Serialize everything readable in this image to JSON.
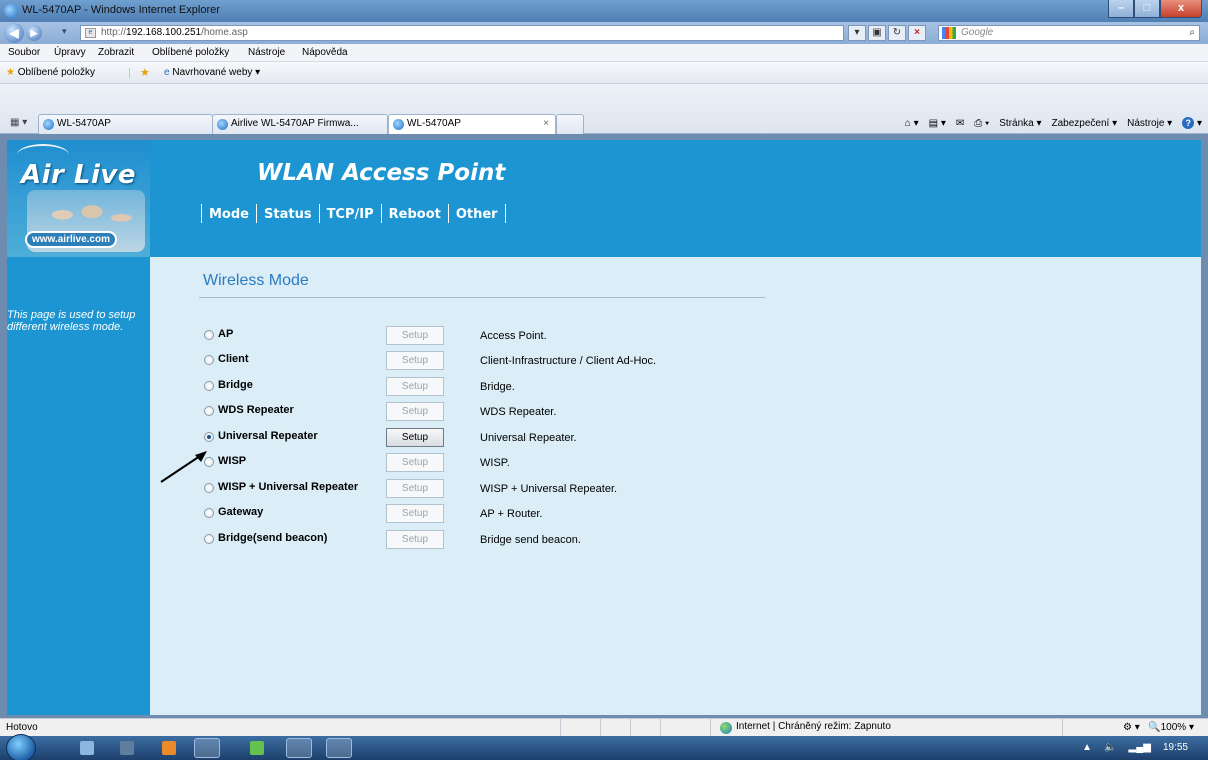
{
  "window": {
    "title": "WL-5470AP - Windows Internet Explorer"
  },
  "address": {
    "prefix": "http://",
    "host": "192.168.100.251",
    "path": "/home.asp",
    "search_placeholder": "Google"
  },
  "menu": [
    "Soubor",
    "Úpravy",
    "Zobrazit",
    "Oblíbené položky",
    "Nástroje",
    "Nápověda"
  ],
  "favorites": {
    "label": "Oblíbené položky",
    "suggested": "Navrhované weby ▾"
  },
  "tabs": [
    {
      "label": "WL-5470AP"
    },
    {
      "label": "Airlive WL-5470AP Firmwa..."
    },
    {
      "label": "WL-5470AP"
    }
  ],
  "commands": [
    "Stránka ▾",
    "Zabezpečení ▾",
    "Nástroje ▾"
  ],
  "banner": {
    "brand": "Air Live",
    "url": "www.airlive.com",
    "title": "WLAN Access Point",
    "nav": [
      "Mode",
      "Status",
      "TCP/IP",
      "Reboot",
      "Other"
    ]
  },
  "sidebar": {
    "help_text": "This page is used to setup different wireless mode."
  },
  "content": {
    "title": "Wireless Mode",
    "setup_label": "Setup",
    "modes": [
      {
        "label": "AP",
        "desc": "Access Point.",
        "selected": false
      },
      {
        "label": "Client",
        "desc": "Client-Infrastructure / Client Ad-Hoc.",
        "selected": false
      },
      {
        "label": "Bridge",
        "desc": "Bridge.",
        "selected": false
      },
      {
        "label": "WDS Repeater",
        "desc": "WDS Repeater.",
        "selected": false
      },
      {
        "label": "Universal Repeater",
        "desc": "Universal Repeater.",
        "selected": true
      },
      {
        "label": "WISP",
        "desc": "WISP.",
        "selected": false
      },
      {
        "label": "WISP + Universal Repeater",
        "desc": "WISP + Universal Repeater.",
        "selected": false
      },
      {
        "label": "Gateway",
        "desc": "AP + Router.",
        "selected": false
      },
      {
        "label": "Bridge(send beacon)",
        "desc": "Bridge send beacon.",
        "selected": false
      }
    ]
  },
  "status": {
    "text": "Hotovo",
    "zone": "Internet | Chráněný režim: Zapnuto",
    "zoom": "100%"
  },
  "taskbar": {
    "time": "19:55"
  },
  "colors": {
    "banner": "#1c95d2",
    "page_bg": "#dbeef8",
    "title_blue": "#2a7bbf"
  }
}
